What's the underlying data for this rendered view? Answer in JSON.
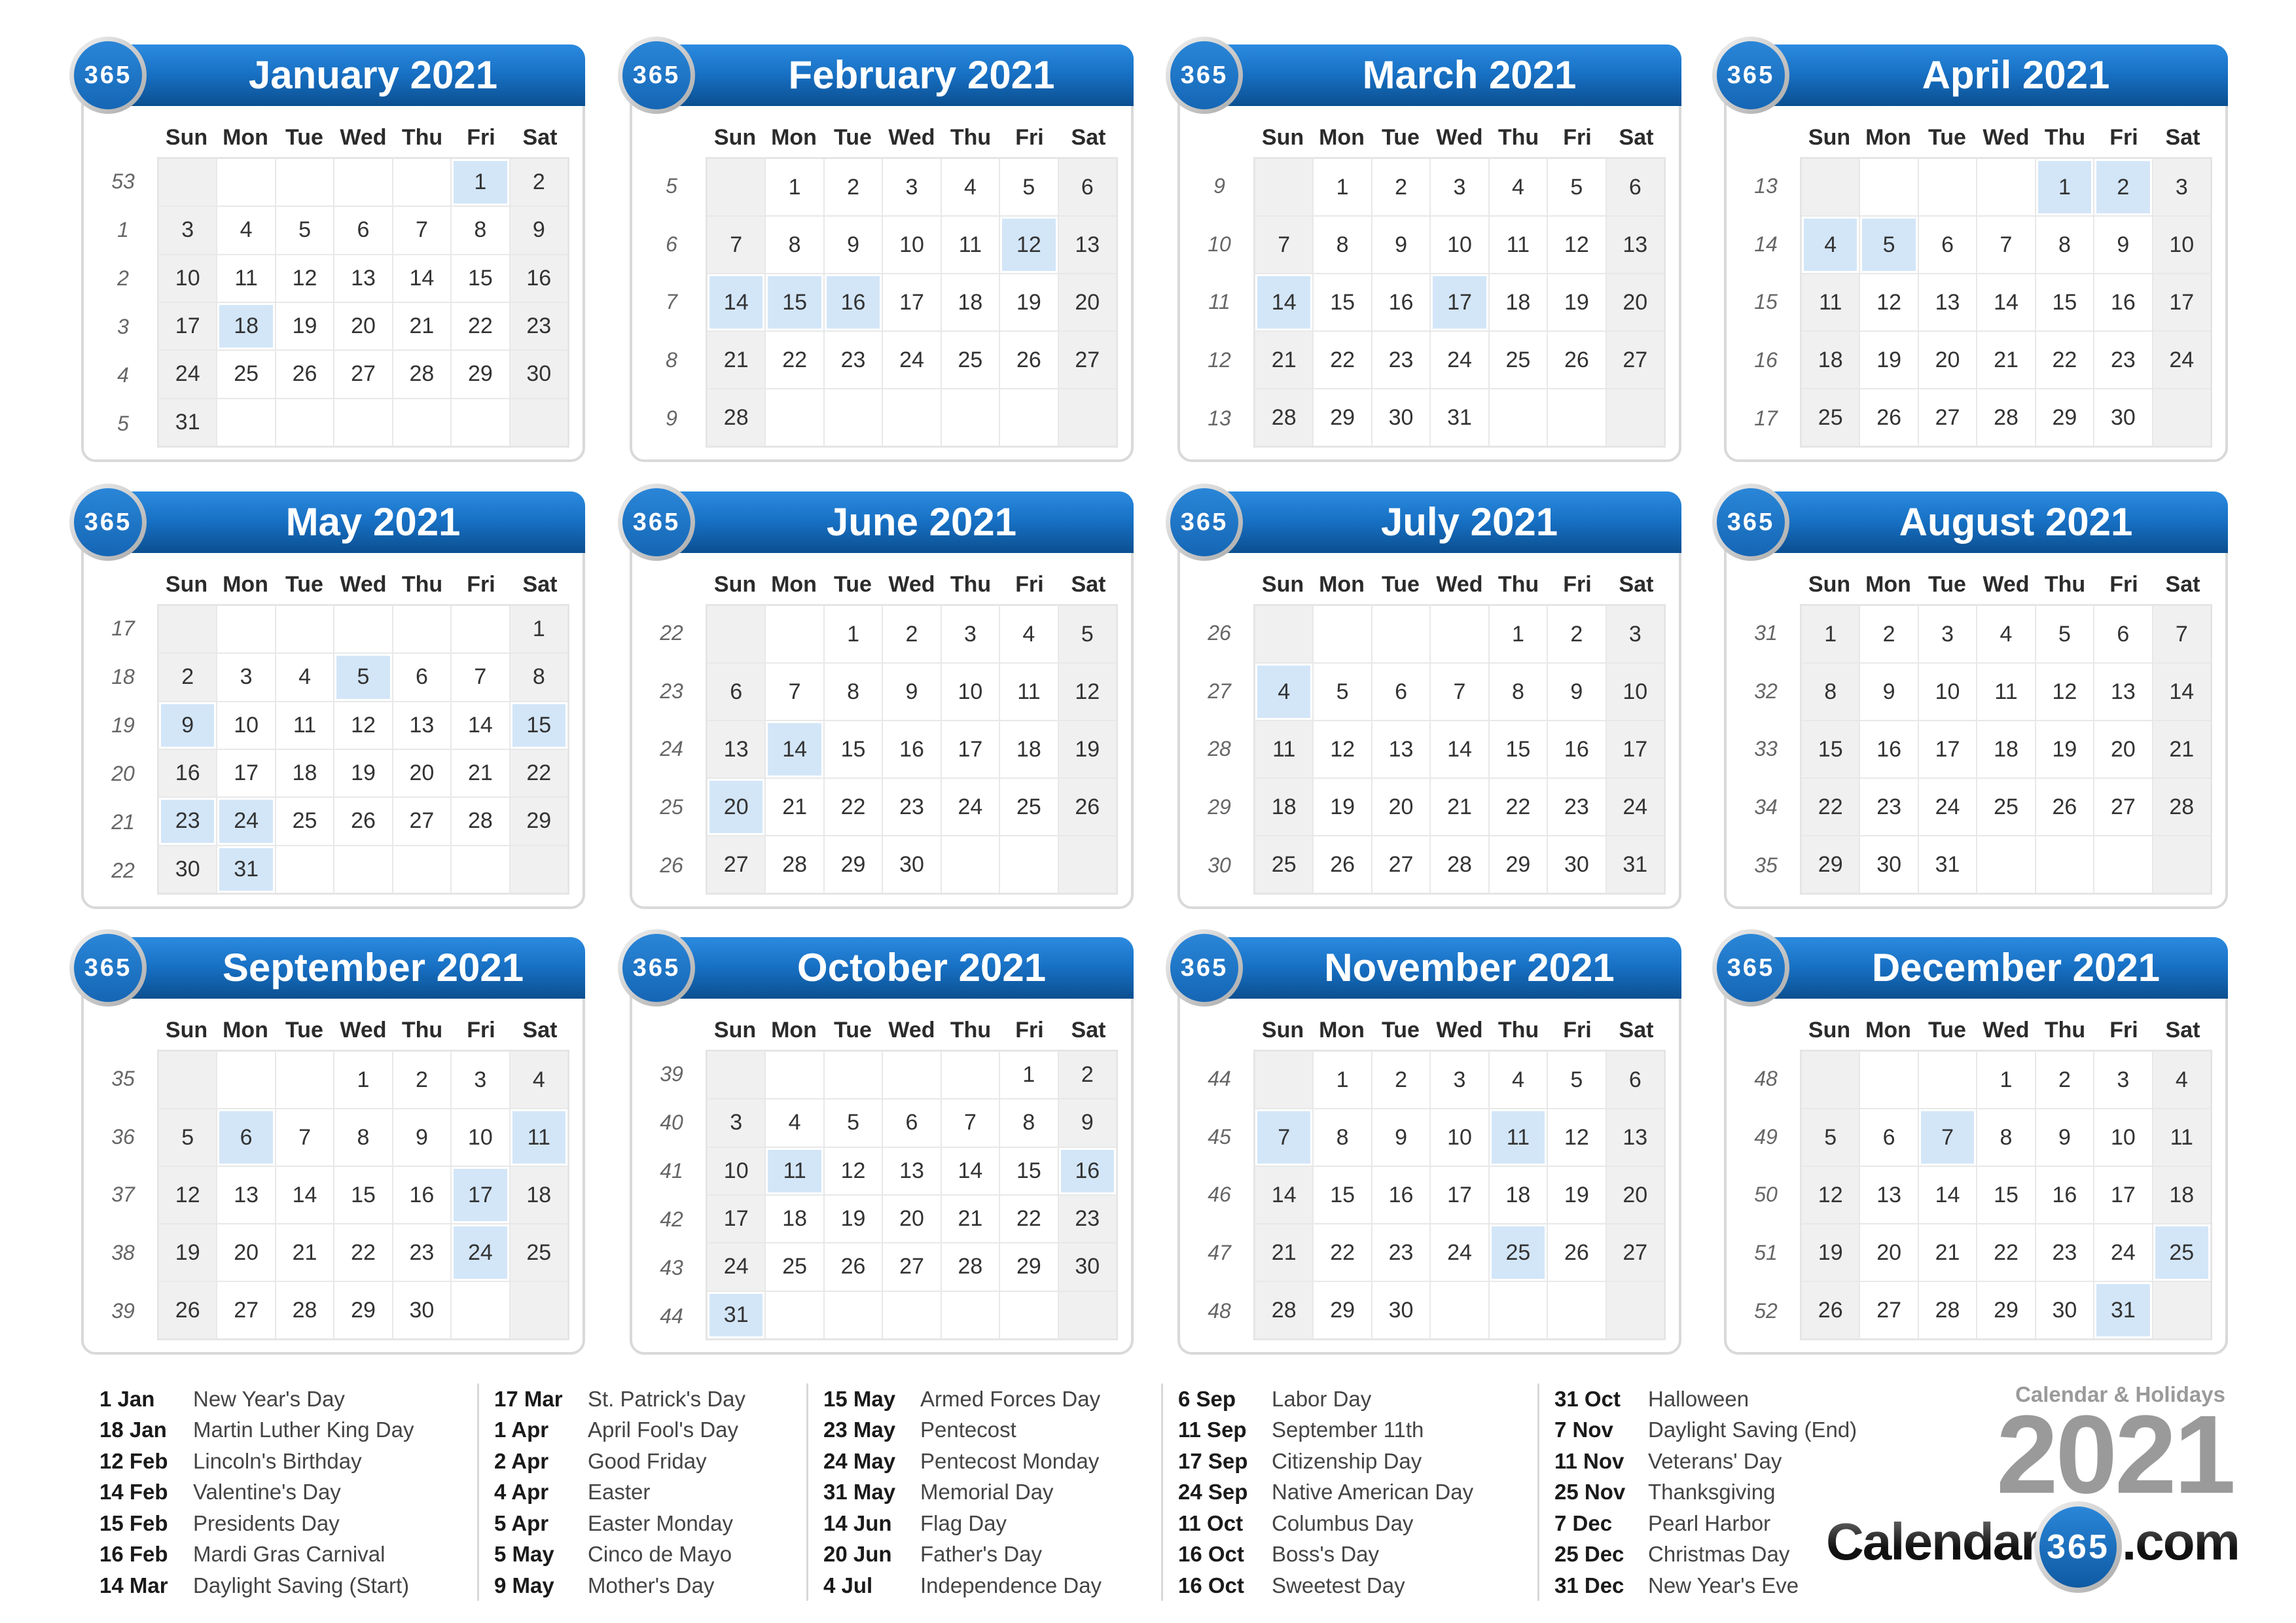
{
  "year": "2021",
  "badge_text": "365",
  "weekday_labels": [
    "Sun",
    "Mon",
    "Tue",
    "Wed",
    "Thu",
    "Fri",
    "Sat"
  ],
  "colors": {
    "header_top": "#2b8be0",
    "header_bottom": "#0b4f90",
    "holiday_cell": "#d3e6f8",
    "weekend_cell": "#f0f0f0",
    "brand_gray": "#9a9a9a"
  },
  "months": [
    {
      "title": "January 2021",
      "first_weekday": 5,
      "days": 31,
      "weeks": [
        "53",
        "1",
        "2",
        "3",
        "4",
        "5"
      ],
      "holidays": [
        1,
        18
      ]
    },
    {
      "title": "February 2021",
      "first_weekday": 1,
      "days": 28,
      "weeks": [
        "5",
        "6",
        "7",
        "8",
        "9"
      ],
      "holidays": [
        12,
        14,
        15,
        16
      ]
    },
    {
      "title": "March 2021",
      "first_weekday": 1,
      "days": 31,
      "weeks": [
        "9",
        "10",
        "11",
        "12",
        "13"
      ],
      "holidays": [
        14,
        17
      ]
    },
    {
      "title": "April 2021",
      "first_weekday": 4,
      "days": 30,
      "weeks": [
        "13",
        "14",
        "15",
        "16",
        "17"
      ],
      "holidays": [
        1,
        2,
        4,
        5
      ]
    },
    {
      "title": "May 2021",
      "first_weekday": 6,
      "days": 31,
      "weeks": [
        "17",
        "18",
        "19",
        "20",
        "21",
        "22"
      ],
      "holidays": [
        5,
        9,
        15,
        23,
        24,
        31
      ]
    },
    {
      "title": "June 2021",
      "first_weekday": 2,
      "days": 30,
      "weeks": [
        "22",
        "23",
        "24",
        "25",
        "26"
      ],
      "holidays": [
        14,
        20
      ]
    },
    {
      "title": "July 2021",
      "first_weekday": 4,
      "days": 31,
      "weeks": [
        "26",
        "27",
        "28",
        "29",
        "30"
      ],
      "holidays": [
        4
      ]
    },
    {
      "title": "August 2021",
      "first_weekday": 0,
      "days": 31,
      "weeks": [
        "31",
        "32",
        "33",
        "34",
        "35"
      ],
      "holidays": []
    },
    {
      "title": "September 2021",
      "first_weekday": 3,
      "days": 30,
      "weeks": [
        "35",
        "36",
        "37",
        "38",
        "39"
      ],
      "holidays": [
        6,
        11,
        17,
        24
      ]
    },
    {
      "title": "October 2021",
      "first_weekday": 5,
      "days": 31,
      "weeks": [
        "39",
        "40",
        "41",
        "42",
        "43",
        "44"
      ],
      "holidays": [
        11,
        16,
        31
      ]
    },
    {
      "title": "November 2021",
      "first_weekday": 1,
      "days": 30,
      "weeks": [
        "44",
        "45",
        "46",
        "47",
        "48"
      ],
      "holidays": [
        7,
        11,
        25
      ]
    },
    {
      "title": "December 2021",
      "first_weekday": 3,
      "days": 31,
      "weeks": [
        "48",
        "49",
        "50",
        "51",
        "52"
      ],
      "holidays": [
        7,
        25,
        31
      ]
    }
  ],
  "holiday_columns": [
    [
      {
        "date": "1 Jan",
        "name": "New Year's Day"
      },
      {
        "date": "18 Jan",
        "name": "Martin Luther King Day"
      },
      {
        "date": "12 Feb",
        "name": "Lincoln's Birthday"
      },
      {
        "date": "14 Feb",
        "name": "Valentine's Day"
      },
      {
        "date": "15 Feb",
        "name": "Presidents Day"
      },
      {
        "date": "16 Feb",
        "name": "Mardi Gras Carnival"
      },
      {
        "date": "14 Mar",
        "name": "Daylight Saving (Start)"
      }
    ],
    [
      {
        "date": "17 Mar",
        "name": "St. Patrick's Day"
      },
      {
        "date": "1 Apr",
        "name": "April Fool's Day"
      },
      {
        "date": "2 Apr",
        "name": "Good Friday"
      },
      {
        "date": "4 Apr",
        "name": "Easter"
      },
      {
        "date": "5 Apr",
        "name": "Easter Monday"
      },
      {
        "date": "5 May",
        "name": "Cinco de Mayo"
      },
      {
        "date": "9 May",
        "name": "Mother's Day"
      }
    ],
    [
      {
        "date": "15 May",
        "name": "Armed Forces Day"
      },
      {
        "date": "23 May",
        "name": "Pentecost"
      },
      {
        "date": "24 May",
        "name": "Pentecost Monday"
      },
      {
        "date": "31 May",
        "name": "Memorial Day"
      },
      {
        "date": "14 Jun",
        "name": "Flag Day"
      },
      {
        "date": "20 Jun",
        "name": "Father's Day"
      },
      {
        "date": "4 Jul",
        "name": "Independence Day"
      }
    ],
    [
      {
        "date": "6 Sep",
        "name": "Labor Day"
      },
      {
        "date": "11 Sep",
        "name": "September 11th"
      },
      {
        "date": "17 Sep",
        "name": "Citizenship Day"
      },
      {
        "date": "24 Sep",
        "name": "Native American Day"
      },
      {
        "date": "11 Oct",
        "name": "Columbus Day"
      },
      {
        "date": "16 Oct",
        "name": "Boss's Day"
      },
      {
        "date": "16 Oct",
        "name": "Sweetest Day"
      }
    ],
    [
      {
        "date": "31 Oct",
        "name": "Halloween"
      },
      {
        "date": "7 Nov",
        "name": "Daylight Saving (End)"
      },
      {
        "date": "11 Nov",
        "name": "Veterans' Day"
      },
      {
        "date": "25 Nov",
        "name": "Thanksgiving"
      },
      {
        "date": "7 Dec",
        "name": "Pearl Harbor"
      },
      {
        "date": "25 Dec",
        "name": "Christmas Day"
      },
      {
        "date": "31 Dec",
        "name": "New Year's Eve"
      }
    ]
  ],
  "branding": {
    "subtitle": "Calendar & Holidays",
    "year": "2021",
    "logo_left": "Calendar-",
    "logo_badge": "365",
    "logo_right": ".com"
  }
}
